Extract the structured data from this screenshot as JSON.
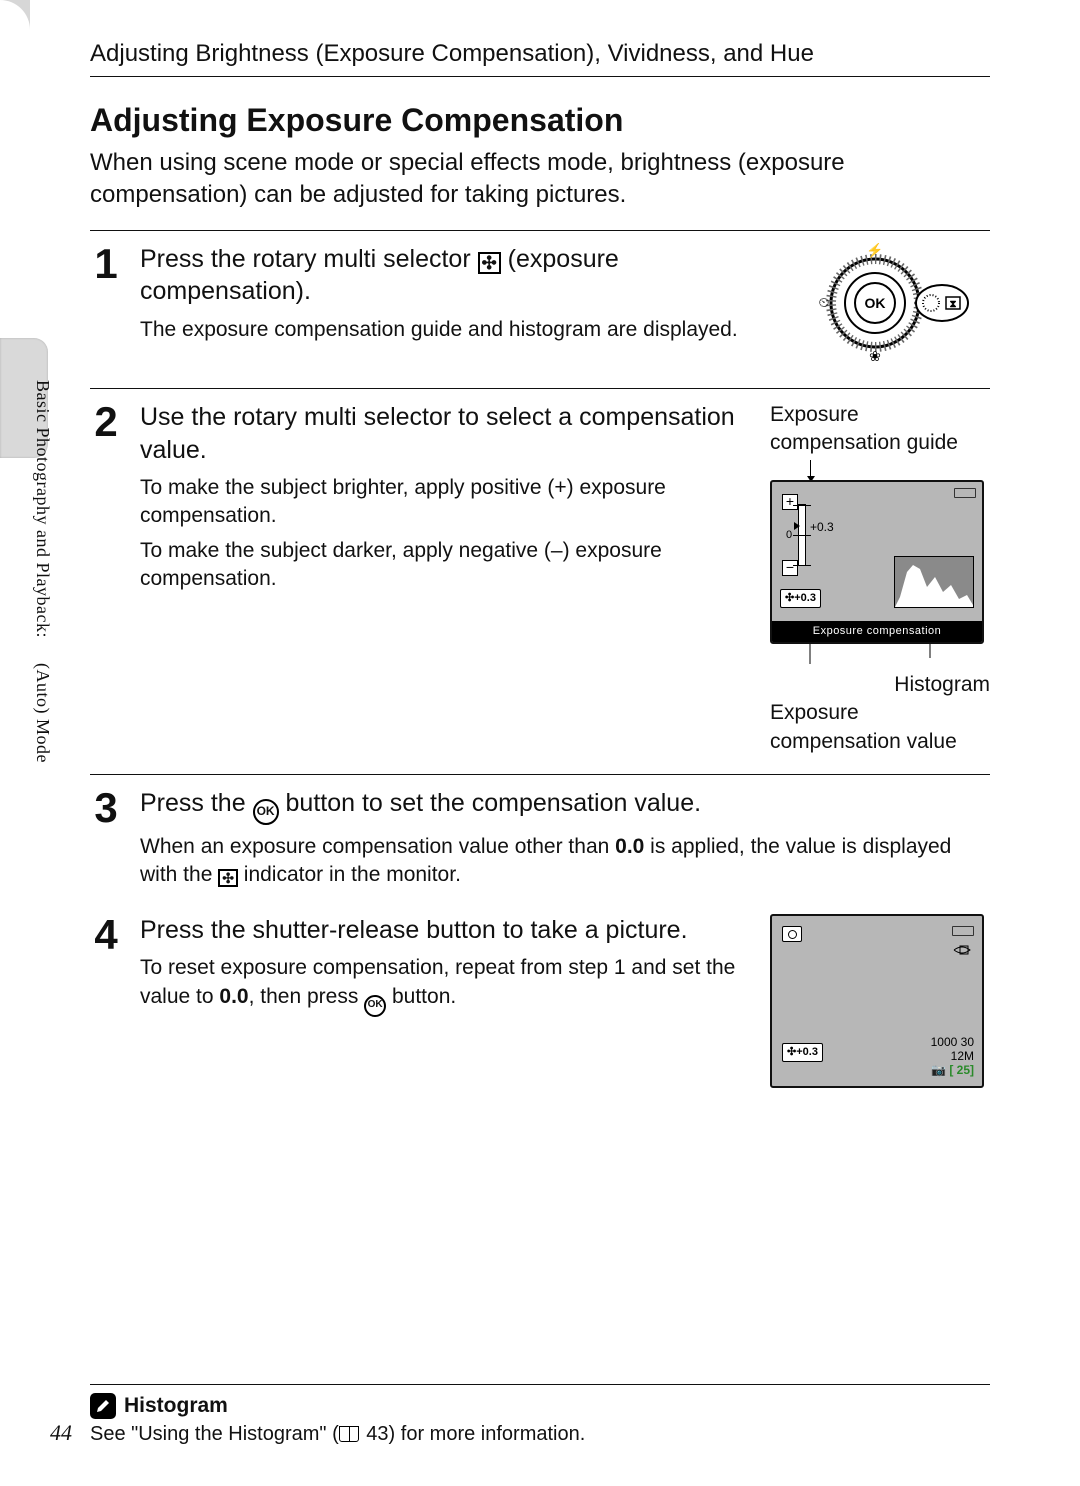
{
  "breadcrumb": "Adjusting Brightness (Exposure Compensation), Vividness, and Hue",
  "side_label": "Basic Photography and Playback:     (Auto) Mode",
  "title": "Adjusting Exposure Compensation",
  "intro": "When using scene mode or special effects mode, brightness (exposure compensation) can be adjusted for taking pictures.",
  "steps": {
    "s1": {
      "num": "1",
      "title_a": "Press the rotary multi selector ",
      "title_b": " (exposure compensation).",
      "desc": "The exposure compensation guide and histogram are displayed."
    },
    "s2": {
      "num": "2",
      "title": "Use the rotary multi selector to select a compensation value.",
      "desc_a": "To make the subject brighter, apply positive (+) exposure compensation.",
      "desc_b": "To make the subject darker, apply negative (–) exposure compensation.",
      "label_guide": "Exposure compensation guide",
      "label_histo": "Histogram",
      "label_value": "Exposure compensation value",
      "lcd": {
        "scale_value": "+0.3",
        "zero": "0",
        "badge": "✣+0.3",
        "footer": "Exposure compensation"
      }
    },
    "s3": {
      "num": "3",
      "title_a": "Press the ",
      "title_b": " button to set the compensation value.",
      "desc_a": "When an exposure compensation value other than ",
      "zero": "0.0",
      "desc_b": " is applied, the value is displayed with the ",
      "desc_c": " indicator in the monitor."
    },
    "s4": {
      "num": "4",
      "title": "Press the shutter-release button to take a picture.",
      "desc_a": "To reset exposure compensation, repeat from step 1 and set the value to ",
      "zero": "0.0",
      "desc_b": ", then press ",
      "desc_c": " button.",
      "lcd": {
        "badge": "✣+0.3",
        "time": "1000  30",
        "mode": "12M",
        "shots": "[   25]"
      }
    }
  },
  "note": {
    "title": "Histogram",
    "body_a": "See \"Using the Histogram\" (",
    "page_ref": " 43) for more information."
  },
  "page_number": "44",
  "icons": {
    "ev": "✣",
    "ok": "OK"
  }
}
